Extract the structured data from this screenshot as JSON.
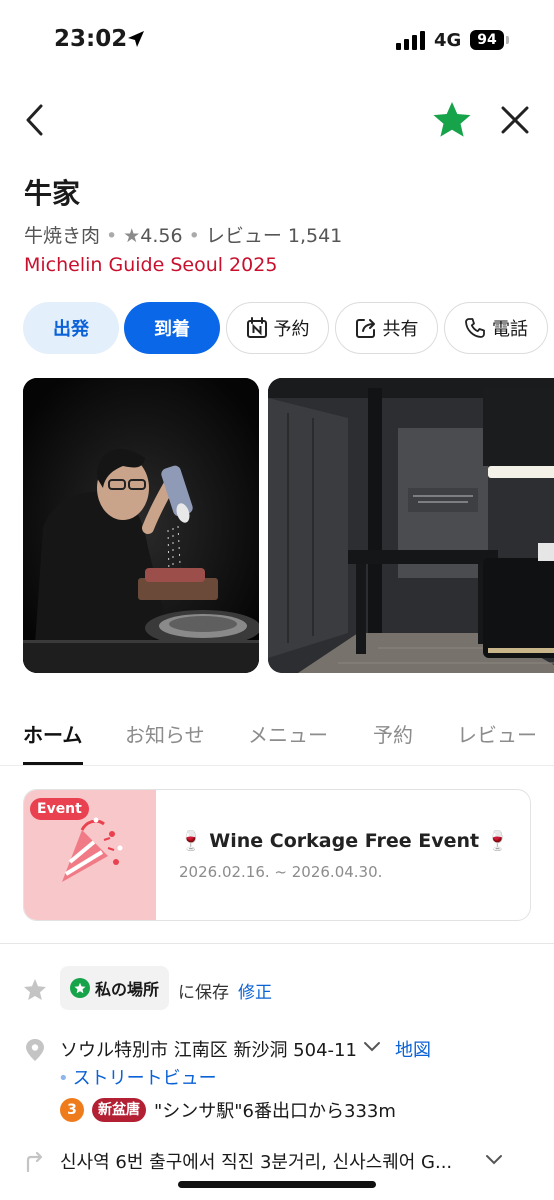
{
  "status_bar": {
    "time": "23:02",
    "network": "4G",
    "battery": "94"
  },
  "place": {
    "name": "牛家",
    "category": "牛焼き肉",
    "rating": "4.56",
    "reviews_label": "レビュー",
    "reviews_count": "1,541",
    "award": "Michelin Guide Seoul 2025"
  },
  "actions": {
    "depart": "出発",
    "arrive": "到着",
    "reserve": "予約",
    "share": "共有",
    "call": "電話"
  },
  "tabs": [
    "ホーム",
    "お知らせ",
    "メニュー",
    "予約",
    "レビュー"
  ],
  "event": {
    "badge": "Event",
    "title": "🍷 Wine Corkage Free Event 🍷",
    "dates": "2026.02.16. ~ 2026.04.30."
  },
  "save": {
    "list_name": "私の場所",
    "saved_text": "に保存",
    "edit_label": "修正"
  },
  "address": {
    "text": "ソウル特別市 江南区 新沙洞 504-11",
    "map_link": "地図",
    "street_view": "ストリートビュー"
  },
  "station": {
    "line_number": "3",
    "line_name": "新盆唐",
    "text": "\"シンサ駅\"6番出口から333m"
  },
  "directions": {
    "text": "신사역 6번 출구에서 직진 3분거리, 신사스퀘어 G..."
  },
  "colors": {
    "accent": "#0a67e8",
    "michelin": "#c8102e",
    "favorite": "#17a34a"
  }
}
